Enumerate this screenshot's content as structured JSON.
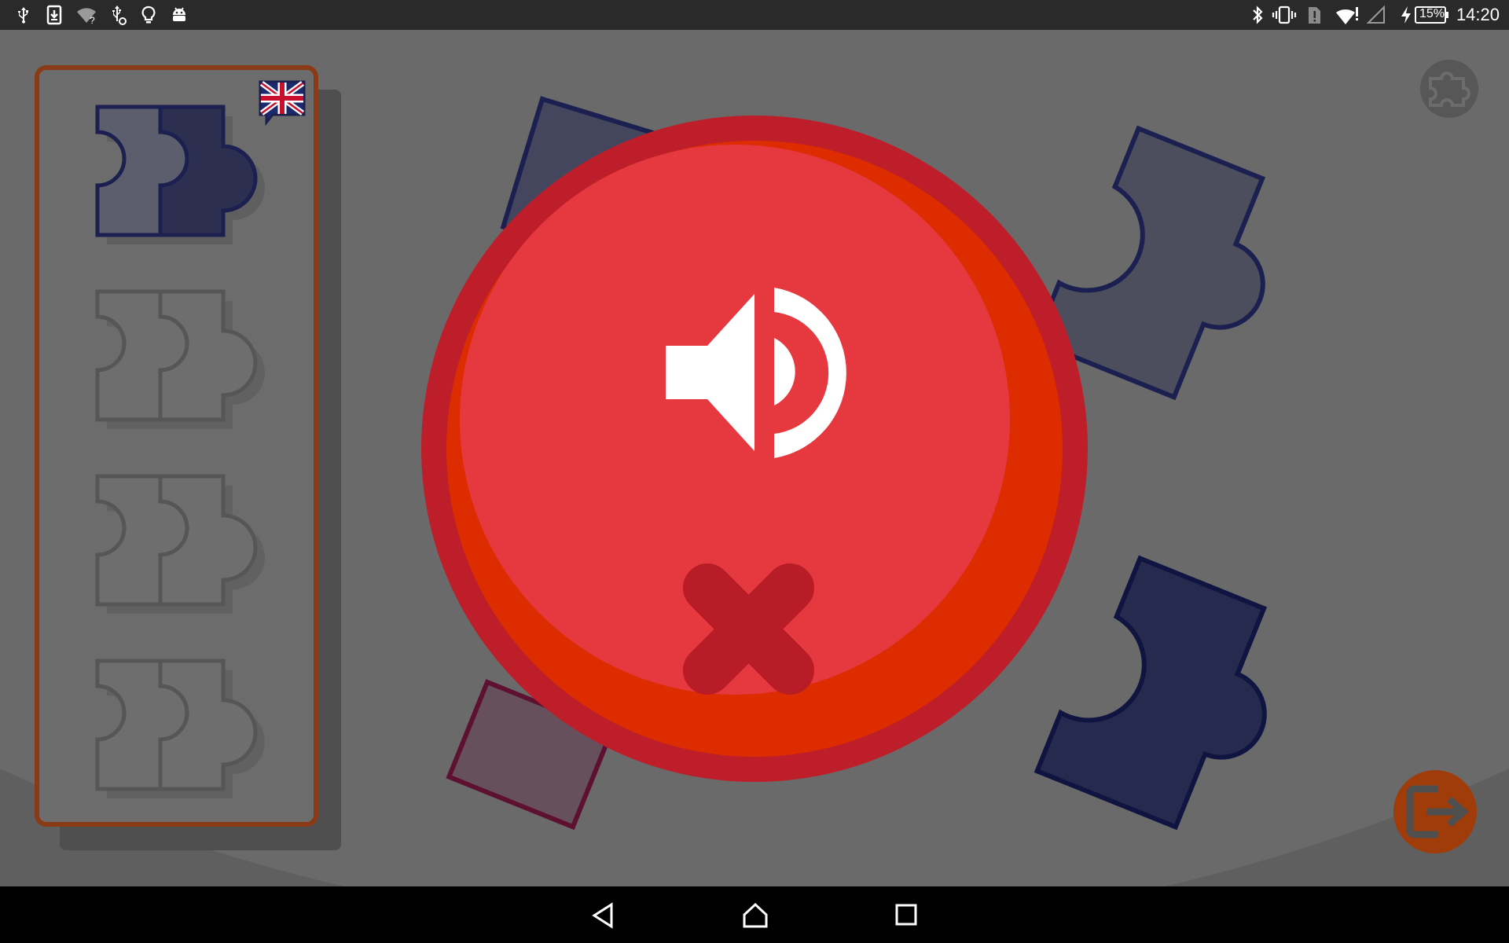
{
  "status_bar": {
    "time": "14:20",
    "battery_percent": "15%",
    "left_icons": [
      "usb-icon",
      "download-icon",
      "wifi-question-icon",
      "usb-debug-icon",
      "lightbulb-icon",
      "android-icon"
    ],
    "right_icons": [
      "bluetooth-icon",
      "vibrate-icon",
      "sim-alert-icon",
      "wifi-icon",
      "signal-icon",
      "charging-icon",
      "battery-icon"
    ]
  },
  "game": {
    "background_color": "#5f5f5f",
    "panel": {
      "border_color": "#8a3a14",
      "language_flag": "uk-flag-icon",
      "slots": [
        {
          "state": "completed",
          "pieces": 2
        },
        {
          "state": "empty",
          "pieces": 2
        },
        {
          "state": "empty",
          "pieces": 2
        },
        {
          "state": "empty",
          "pieces": 2
        }
      ]
    },
    "popup": {
      "colors": {
        "outer": "#bd1e2a",
        "inner": "#e5383f",
        "shade": "#dd2c00",
        "cross": "#b81c26"
      },
      "icons": [
        "speaker-icon",
        "close-icon"
      ]
    },
    "puzzle_button_icon": "puzzle-icon",
    "exit_button_icon": "exit-icon",
    "exit_button_color": "#a03c0a"
  },
  "nav_bar": {
    "icons": [
      "back-icon",
      "home-icon",
      "recents-icon"
    ]
  }
}
